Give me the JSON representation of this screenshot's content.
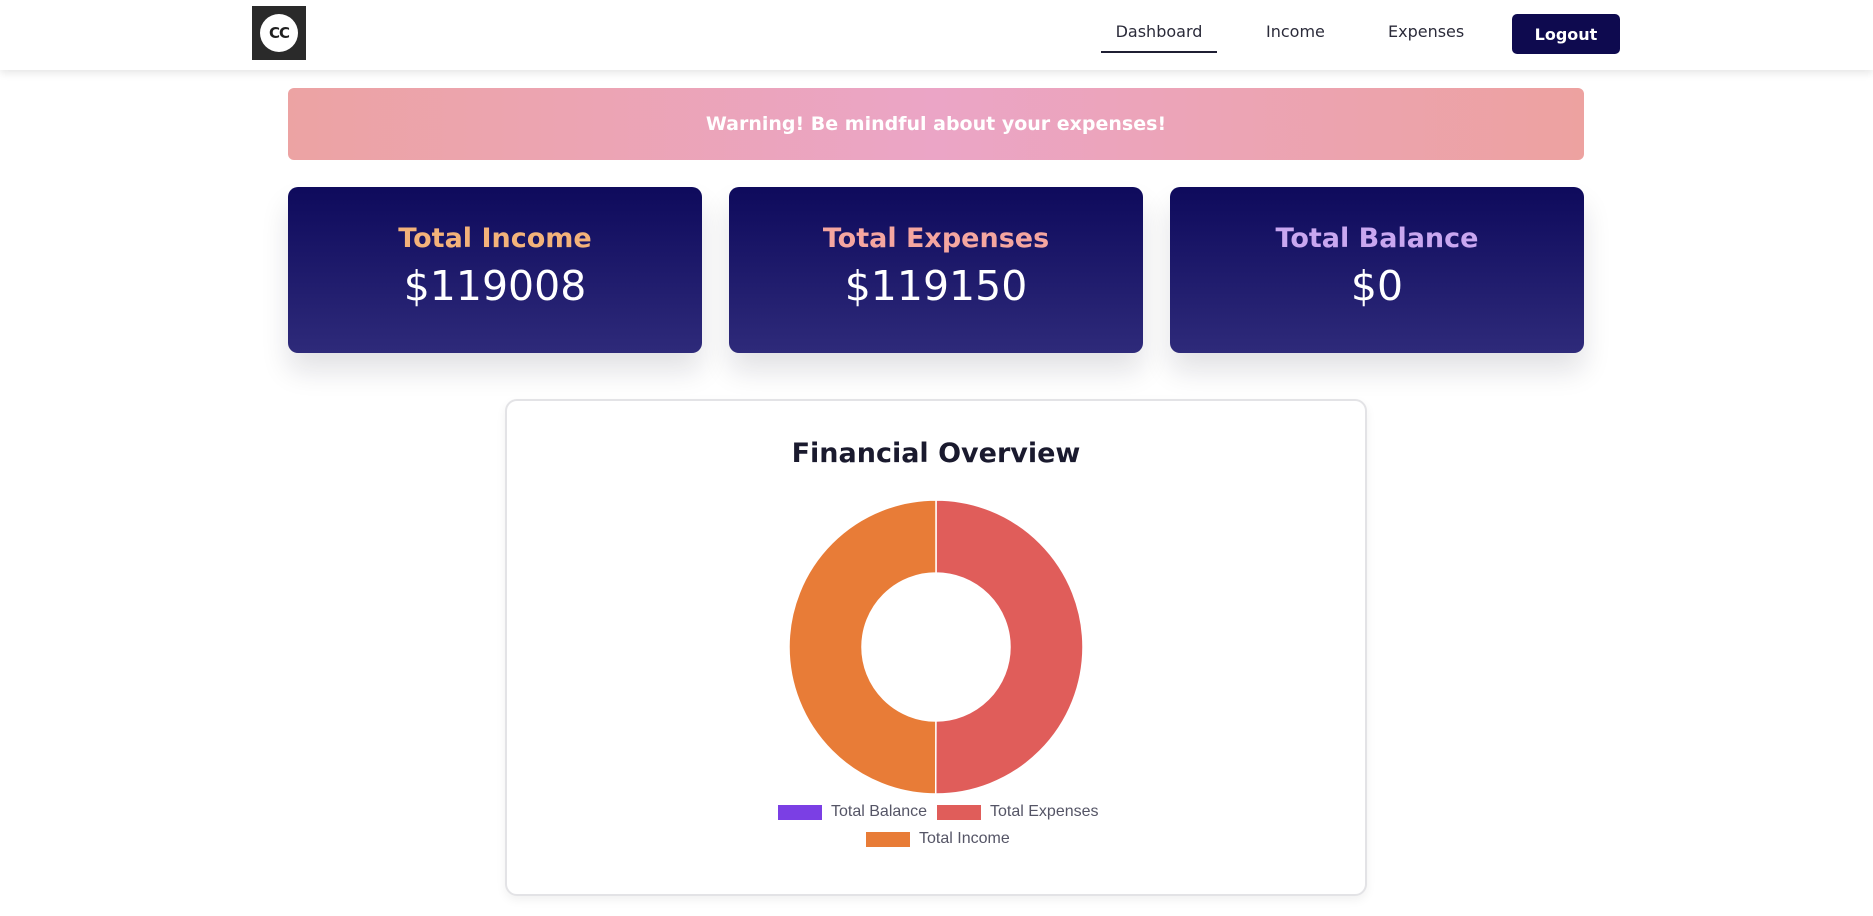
{
  "header": {
    "logo_text": "CC",
    "nav": {
      "dashboard": "Dashboard",
      "income": "Income",
      "expenses": "Expenses"
    },
    "logout_label": "Logout"
  },
  "warning": {
    "text": "Warning! Be mindful about your expenses!"
  },
  "cards": [
    {
      "title": "Total Income",
      "value": "$119008",
      "title_color": "#f3b27a"
    },
    {
      "title": "Total Expenses",
      "value": "$119150",
      "title_color": "#f5a6a0"
    },
    {
      "title": "Total Balance",
      "value": "$0",
      "title_color": "#c9a7f0"
    }
  ],
  "overview": {
    "title": "Financial Overview"
  },
  "chart_data": {
    "type": "pie",
    "variant": "doughnut",
    "title": "Financial Overview",
    "categories": [
      "Total Balance",
      "Total Expenses",
      "Total Income"
    ],
    "values": [
      0,
      119150,
      119008
    ],
    "colors": [
      "#7b3fe4",
      "#e05d5a",
      "#e87c37"
    ],
    "legend_position": "bottom"
  }
}
